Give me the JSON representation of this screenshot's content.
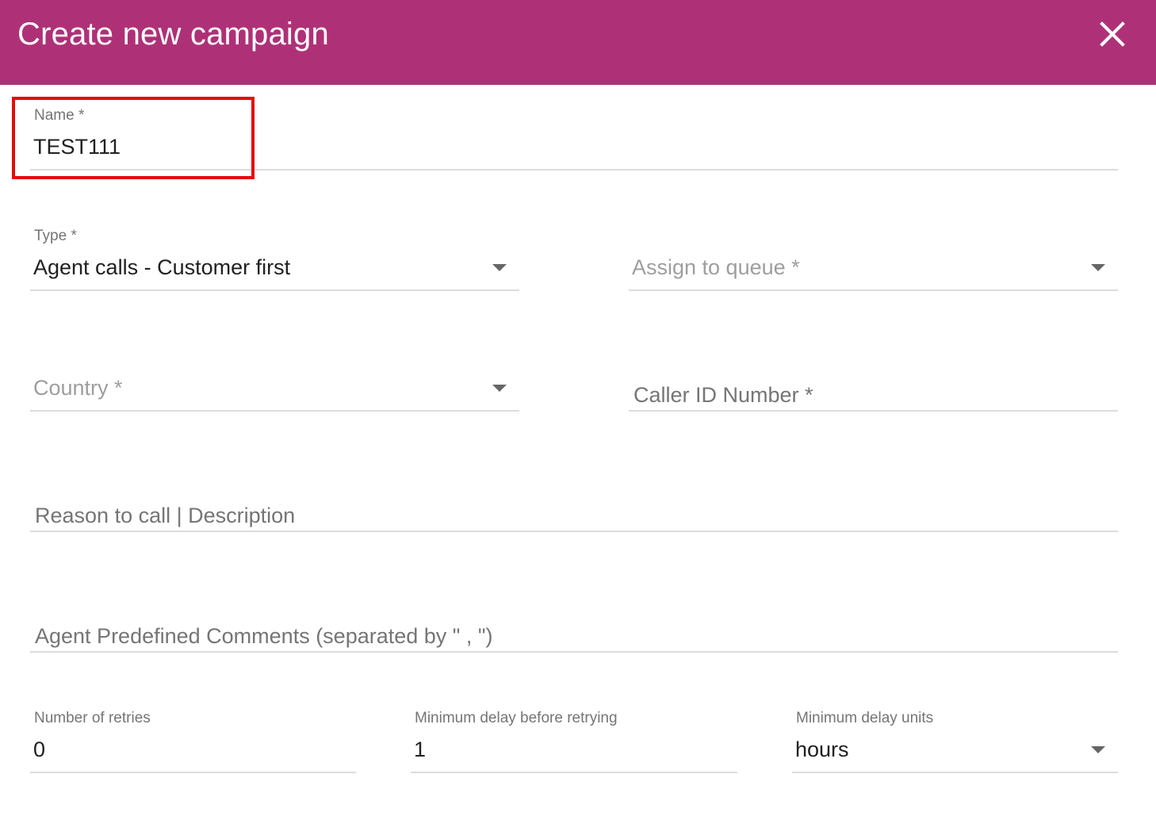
{
  "dialog": {
    "title": "Create new campaign"
  },
  "colors": {
    "header_bg": "#ae3177",
    "header_text": "#ffffff",
    "highlight": "#e40b0b"
  },
  "icons": {
    "close": "close-icon",
    "dropdown": "caret-down-icon"
  },
  "form": {
    "name": {
      "label": "Name *",
      "value": "TEST111"
    },
    "type": {
      "label": "Type *",
      "value": "Agent calls - Customer first"
    },
    "assign_queue": {
      "placeholder": "Assign to queue *"
    },
    "country": {
      "placeholder": "Country *"
    },
    "caller_id": {
      "placeholder": "Caller ID Number *"
    },
    "reason": {
      "placeholder": "Reason to call | Description"
    },
    "agent_comments": {
      "placeholder": "Agent Predefined Comments (separated by \" , \")"
    },
    "retries": {
      "label": "Number of retries",
      "value": "0"
    },
    "min_delay": {
      "label": "Minimum delay before retrying",
      "value": "1"
    },
    "delay_units": {
      "label": "Minimum delay units",
      "value": "hours"
    }
  }
}
